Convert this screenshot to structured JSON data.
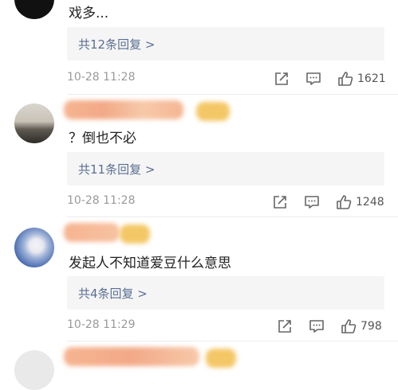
{
  "comments": [
    {
      "text": "戏多...",
      "replies_label": "共12条回复 >",
      "time": "10-28 11:28",
      "likes": "1621"
    },
    {
      "text": "？倒也不必",
      "replies_label": "共11条回复 >",
      "time": "10-28 11:28",
      "likes": "1248"
    },
    {
      "text": "发起人不知道爱豆什么意思",
      "replies_label": "共4条回复 >",
      "time": "10-28 11:29",
      "likes": "798"
    }
  ],
  "icons": {
    "share": "share-icon",
    "comment": "comment-icon",
    "like": "thumbs-up-icon"
  },
  "colors": {
    "reply_link": "#5a6f93",
    "timestamp": "#9a9a9a",
    "reply_box_bg": "#f5f5f5",
    "name_blur": "#f7b08a"
  }
}
